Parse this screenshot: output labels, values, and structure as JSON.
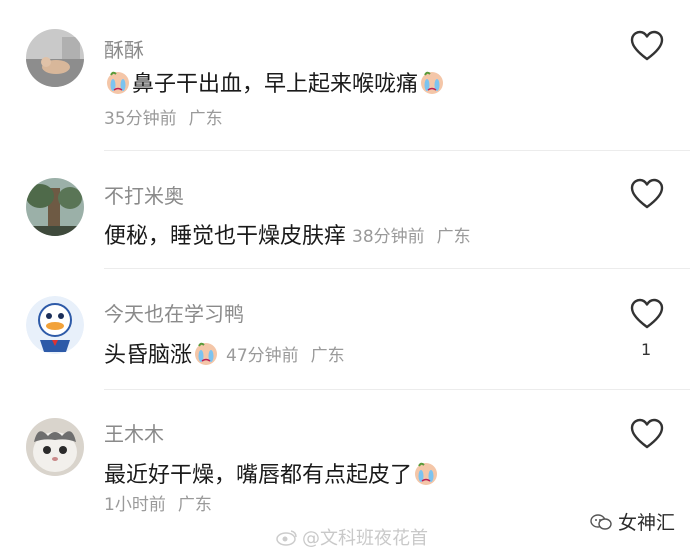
{
  "comments": [
    {
      "username": "酥酥",
      "text": "鼻子干出血，早上起来喉咙痛",
      "time": "35分钟前",
      "location": "广东",
      "likes": ""
    },
    {
      "username": "不打米奥",
      "text": "便秘，睡觉也干燥皮肤痒",
      "time": "38分钟前",
      "location": "广东",
      "likes": ""
    },
    {
      "username": "今天也在学习鸭",
      "text": "头昏脑涨",
      "time": "47分钟前",
      "location": "广东",
      "likes": "1"
    },
    {
      "username": "王木木",
      "text": "最近好干燥，嘴唇都有点起皮了",
      "time": "1小时前",
      "location": "广东",
      "likes": ""
    }
  ],
  "watermark": "@文科班夜花首",
  "brand": "女神汇",
  "icons": {
    "like": "heart-outline-icon",
    "emoji": "crying-face-emoji",
    "watermark": "weibo-logo-icon",
    "brand": "wechat-logo-icon"
  }
}
